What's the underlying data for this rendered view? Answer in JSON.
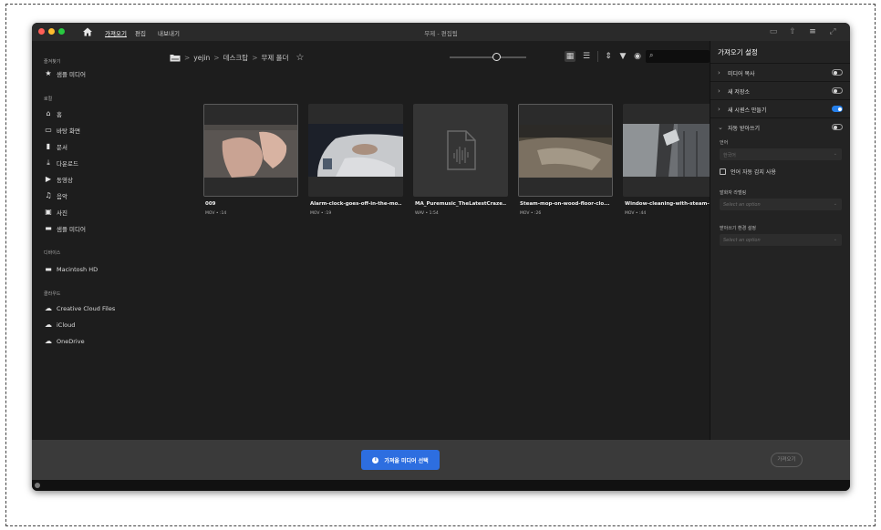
{
  "titlebar": {
    "tabs": [
      {
        "label": "가져오기",
        "active": true
      },
      {
        "label": "편집",
        "active": false
      },
      {
        "label": "내보내기",
        "active": false
      }
    ],
    "title": "무제 - 편집됨"
  },
  "sidebar": {
    "favorites_heading": "즐겨찾기",
    "favorites": [
      {
        "label": "샘플 미디어",
        "icon": "star-icon"
      }
    ],
    "local_heading": "로컬",
    "local": [
      {
        "label": "홈",
        "icon": "home-icon"
      },
      {
        "label": "바탕 화면",
        "icon": "desktop-icon"
      },
      {
        "label": "문서",
        "icon": "document-icon"
      },
      {
        "label": "다운로드",
        "icon": "download-icon"
      },
      {
        "label": "동영상",
        "icon": "video-icon"
      },
      {
        "label": "음악",
        "icon": "music-icon"
      },
      {
        "label": "사진",
        "icon": "photo-icon"
      },
      {
        "label": "샘플 미디어",
        "icon": "folder-icon"
      }
    ],
    "devices_heading": "디바이스",
    "devices": [
      {
        "label": "Macintosh HD",
        "icon": "folder-icon"
      }
    ],
    "cloud_heading": "클라우드",
    "cloud": [
      {
        "label": "Creative Cloud Files",
        "icon": "cloud-icon"
      },
      {
        "label": "iCloud",
        "icon": "cloud-icon"
      },
      {
        "label": "OneDrive",
        "icon": "cloud-icon"
      }
    ]
  },
  "breadcrumb": {
    "items": [
      "yejin",
      "데스크탑",
      "무제 폴더"
    ],
    "separator": ">"
  },
  "search": {
    "placeholder": ""
  },
  "media": [
    {
      "name": "009",
      "meta": "MOV • :14",
      "selected": true
    },
    {
      "name": "Alarm-clock-goes-off-in-the-mo...",
      "meta": "MOV • :19",
      "selected": false
    },
    {
      "name": "MA_Puremusic_TheLatestCraze...",
      "meta": "WAV • 1:54",
      "selected": false
    },
    {
      "name": "Steam-mop-on-wood-floor-clo...",
      "meta": "MOV • :26",
      "selected": true
    },
    {
      "name": "Window-cleaning-with-steam-9...",
      "meta": "MOV • :44",
      "selected": false
    }
  ],
  "panel": {
    "title": "가져오기 설정",
    "rows": [
      {
        "label": "미디어 복사",
        "expanded": false,
        "toggle": false
      },
      {
        "label": "새 저장소",
        "expanded": false,
        "toggle": false
      },
      {
        "label": "새 시퀀스 만들기",
        "expanded": false,
        "toggle": true
      },
      {
        "label": "자동 받아쓰기",
        "expanded": true,
        "toggle": false
      }
    ],
    "language_label": "언어",
    "language_value": "한국어",
    "auto_detect_label": "언어 자동 감지 사용",
    "speaker_label": "발화자 라벨링",
    "speaker_placeholder": "Select an option",
    "transcribe_pref_label": "받아쓰기 환경 설정",
    "transcribe_pref_placeholder": "Select an option"
  },
  "bottom": {
    "select_media_label": "가져올 미디어 선택",
    "import_label": "가져오기"
  },
  "colors": {
    "accent": "#2680eb",
    "window_bg": "#1d1d1d",
    "panel_bg": "#232323",
    "bottom_bar": "#3a3a3a"
  }
}
